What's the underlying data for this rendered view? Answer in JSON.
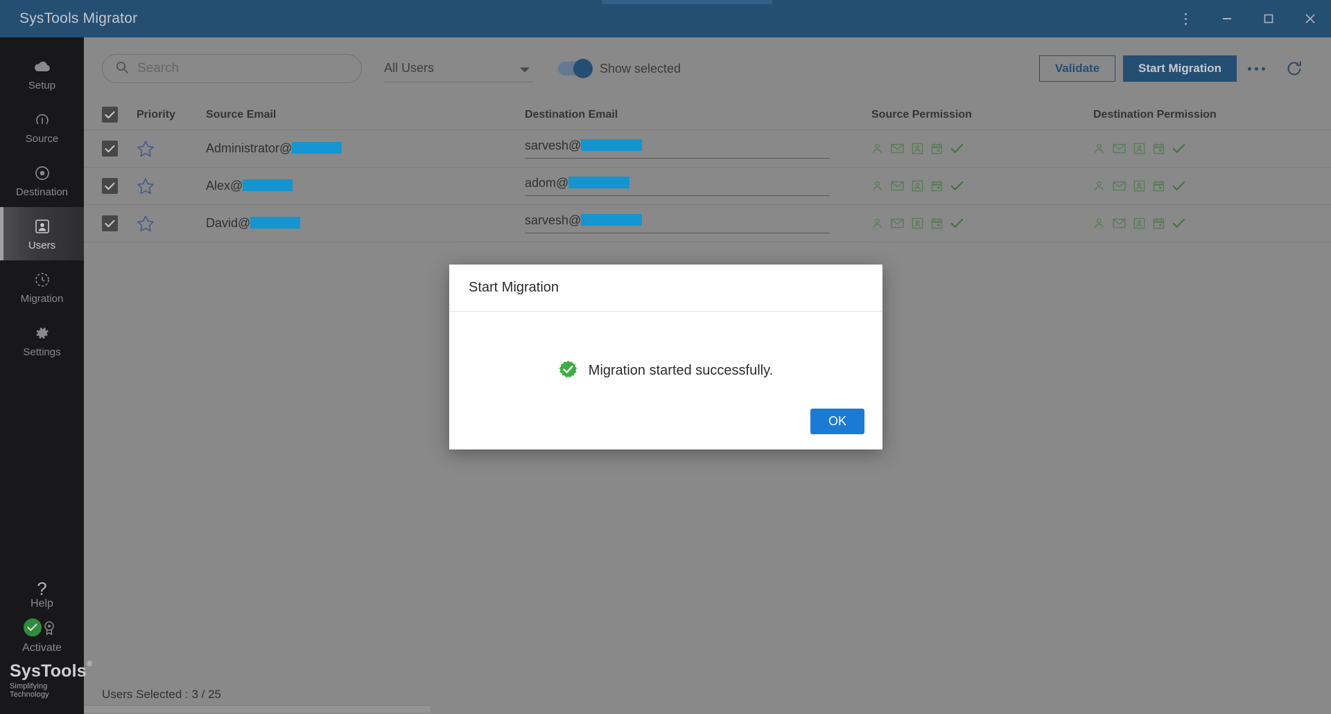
{
  "window": {
    "title": "SysTools Migrator",
    "controls": [
      {
        "name": "menu-kebab",
        "label": "⋮"
      },
      {
        "name": "minimize",
        "label": "—"
      },
      {
        "name": "maximize",
        "label": "▢"
      },
      {
        "name": "close",
        "label": "✕"
      }
    ]
  },
  "sidebar": {
    "items": [
      {
        "label": "Setup",
        "icon": "cloud-icon",
        "active": false
      },
      {
        "label": "Source",
        "icon": "source-icon",
        "active": false
      },
      {
        "label": "Destination",
        "icon": "target-icon",
        "active": false
      },
      {
        "label": "Users",
        "icon": "user-icon",
        "active": true
      },
      {
        "label": "Migration",
        "icon": "clock-icon",
        "active": false
      },
      {
        "label": "Settings",
        "icon": "gear-icon",
        "active": false
      }
    ],
    "help": {
      "label": "Help",
      "glyph": "?"
    },
    "activate": {
      "label": "Activate",
      "icon": "badge-icon",
      "status_icon": "green-check-icon"
    },
    "brand": {
      "name": "SysTools",
      "registered": "®",
      "tagline": "Simplifying Technology"
    }
  },
  "toolbar": {
    "search": {
      "placeholder": "Search",
      "value": "",
      "icon": "search-icon"
    },
    "filter": {
      "selected": "All Users",
      "options": [
        "All Users"
      ],
      "icon": "chevron-down-icon"
    },
    "show_selected": {
      "label": "Show selected",
      "on": true
    },
    "validate_label": "Validate",
    "start_migration_label": "Start Migration",
    "more_label": "•••",
    "refresh_icon": "refresh-icon"
  },
  "table": {
    "columns": [
      "Priority",
      "Source Email",
      "Destination Email",
      "Source Permission",
      "Destination Permission"
    ],
    "select_all": true,
    "permission_icons": [
      "contact-icon",
      "mail-icon",
      "card-icon",
      "calendar-icon",
      "check-icon"
    ],
    "rows": [
      {
        "checked": true,
        "priority_starred": false,
        "source_email_prefix": "Administrator@",
        "source_redacted_width": 72,
        "destination_email_prefix": "sarvesh@",
        "destination_redacted_width": 88
      },
      {
        "checked": true,
        "priority_starred": false,
        "source_email_prefix": "Alex@",
        "source_redacted_width": 72,
        "destination_email_prefix": "adom@",
        "destination_redacted_width": 88
      },
      {
        "checked": true,
        "priority_starred": false,
        "source_email_prefix": "David@",
        "source_redacted_width": 72,
        "destination_email_prefix": "sarvesh@",
        "destination_redacted_width": 88
      }
    ]
  },
  "statusbar": {
    "users_selected": "Users Selected : 3 / 25"
  },
  "dialog": {
    "title": "Start Migration",
    "message": "Migration started successfully.",
    "status_icon": "success-check-icon",
    "ok_label": "OK"
  },
  "colors": {
    "titlebar": "#20527f",
    "accent": "#20527f",
    "sidebar": "#111114",
    "surface": "#9a9a9a",
    "redaction": "#0ca9f0",
    "success": "#2e9e3e",
    "permission": "#5c8a5c",
    "dialog_button": "#1a7ad4"
  }
}
